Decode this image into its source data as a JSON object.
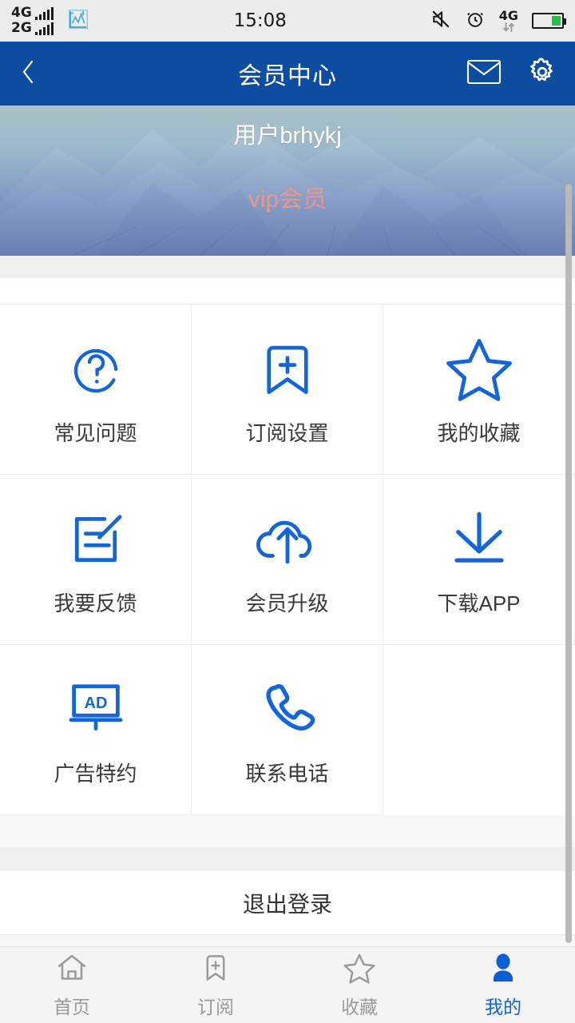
{
  "statusbar": {
    "sim1_label": "4G",
    "sim2_label": "2G",
    "app_icon": "chart-app-icon",
    "time": "15:08",
    "mute_icon": "mute-icon",
    "alarm_icon": "alarm-clock-icon",
    "data_label": "4G",
    "battery_icon": "battery-icon",
    "battery_level": "35"
  },
  "header": {
    "back_icon": "back-chevron-icon",
    "title": "会员中心",
    "mail_icon": "envelope-icon",
    "settings_icon": "gear-icon"
  },
  "banner": {
    "username": "用户brhykj",
    "vip_label": "vip会员"
  },
  "grid": {
    "items": [
      {
        "icon": "question-circle-icon",
        "label": "常见问题"
      },
      {
        "icon": "bookmark-plus-icon",
        "label": "订阅设置"
      },
      {
        "icon": "star-outline-icon",
        "label": "我的收藏"
      },
      {
        "icon": "edit-note-icon",
        "label": "我要反馈"
      },
      {
        "icon": "cloud-upload-icon",
        "label": "会员升级"
      },
      {
        "icon": "download-icon",
        "label": "下载APP"
      },
      {
        "icon": "ad-board-icon",
        "label": "广告特约"
      },
      {
        "icon": "phone-icon",
        "label": "联系电话"
      }
    ]
  },
  "logout": {
    "label": "退出登录"
  },
  "tabbar": {
    "items": [
      {
        "icon": "home-icon",
        "label": "首页",
        "active": false
      },
      {
        "icon": "bookmark-plus-icon",
        "label": "订阅",
        "active": false
      },
      {
        "icon": "star-outline-icon",
        "label": "收藏",
        "active": false
      },
      {
        "icon": "person-icon",
        "label": "我的",
        "active": true
      }
    ]
  },
  "colors": {
    "header_blue": "#0c4da2",
    "icon_blue": "#1466d6",
    "accent_blue": "#0a66d6",
    "vip_salmon": "#ed9589",
    "tab_inactive": "#9a9a9a"
  }
}
